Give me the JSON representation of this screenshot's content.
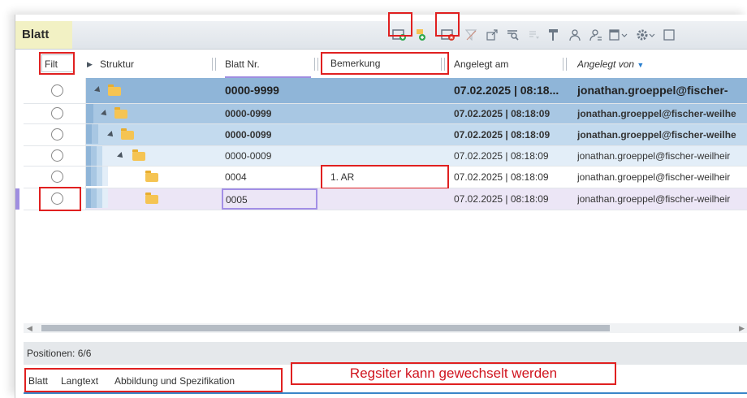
{
  "panel": {
    "title": "Blatt"
  },
  "toolbar": {
    "icons": [
      "new-folder-icon",
      "add-child-icon",
      "delete-folder-icon",
      "filter-icon",
      "expand-icon",
      "search-icon",
      "filter-clear-icon",
      "paint-roller-icon",
      "user-icon",
      "user-search-icon",
      "layout-icon",
      "settings-icon"
    ]
  },
  "columns": {
    "filter": "Filt",
    "struktur": "Struktur",
    "blatt_nr": "Blatt Nr.",
    "bemerkung": "Bemerkung",
    "angelegt_am": "Angelegt am",
    "angelegt_von": "Angelegt von"
  },
  "rows": [
    {
      "level": 0,
      "blatt_nr": "0000-9999",
      "bemerkung": "",
      "angelegt_am": "07.02.2025 | 08:18...",
      "angelegt_von": "jonathan.groeppel@fischer-"
    },
    {
      "level": 1,
      "blatt_nr": "0000-0999",
      "bemerkung": "",
      "angelegt_am": "07.02.2025 | 08:18:09",
      "angelegt_von": "jonathan.groeppel@fischer-weilhe"
    },
    {
      "level": 2,
      "blatt_nr": "0000-0099",
      "bemerkung": "",
      "angelegt_am": "07.02.2025 | 08:18:09",
      "angelegt_von": "jonathan.groeppel@fischer-weilhe"
    },
    {
      "level": 3,
      "blatt_nr": "0000-0009",
      "bemerkung": "",
      "angelegt_am": "07.02.2025 | 08:18:09",
      "angelegt_von": "jonathan.groeppel@fischer-weilheir"
    },
    {
      "level": 4,
      "blatt_nr": "0004",
      "bemerkung": "1. AR",
      "angelegt_am": "07.02.2025 | 08:18:09",
      "angelegt_von": "jonathan.groeppel@fischer-weilheir"
    },
    {
      "level": 4,
      "blatt_nr": "0005",
      "bemerkung": "",
      "angelegt_am": "07.02.2025 | 08:18:09",
      "angelegt_von": "jonathan.groeppel@fischer-weilheir"
    }
  ],
  "status": {
    "text": "Positionen: 6/6"
  },
  "tabs": [
    "Blatt",
    "Langtext",
    "Abbildung und Spezifikation"
  ],
  "annotation": "Regsiter kann gewechselt werden",
  "colors": {
    "highlight": "#e02020",
    "row_level0": "#8fb5d8",
    "row_level1": "#a8c7e3",
    "row_level2": "#c3daee",
    "row_level3": "#e3eef8",
    "selected_row": "#ece6f6"
  }
}
